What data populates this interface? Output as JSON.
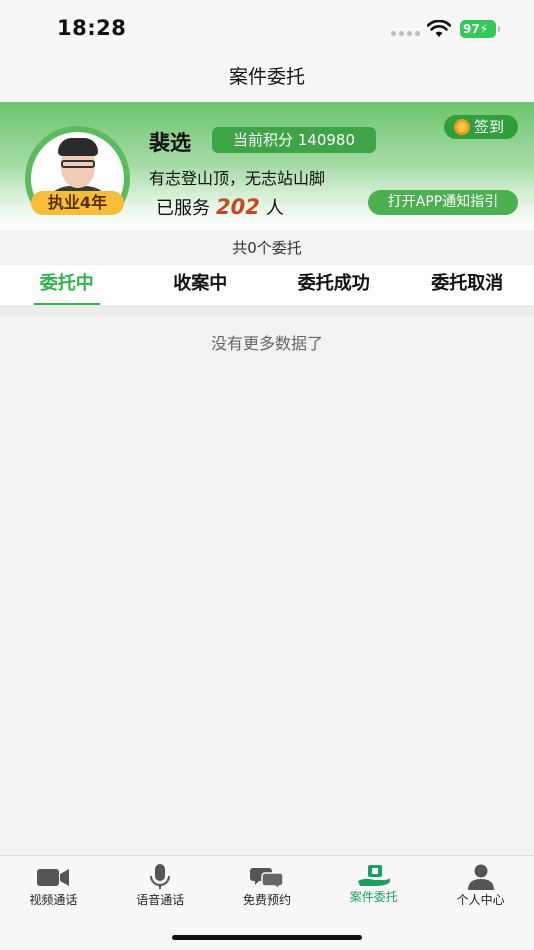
{
  "status": {
    "time": "18:28",
    "battery": "97"
  },
  "nav": {
    "title": "案件委托"
  },
  "profile": {
    "name": "裴选",
    "points_label": "当前积分 140980",
    "signin_label": "签到",
    "motto": "有志登山顶，无志站山脚",
    "served_prefix": "已服务",
    "served_count": "202",
    "served_suffix": "人",
    "years_badge": "执业4年",
    "app_guide_label": "打开APP通知指引"
  },
  "summary": {
    "count_text": "共0个委托"
  },
  "tabs": [
    {
      "label": "委托中",
      "active": true
    },
    {
      "label": "收案中",
      "active": false
    },
    {
      "label": "委托成功",
      "active": false
    },
    {
      "label": "委托取消",
      "active": false
    }
  ],
  "empty_message": "没有更多数据了",
  "tabbar": [
    {
      "label": "视频通话",
      "icon": "video-camera-icon"
    },
    {
      "label": "语音通话",
      "icon": "microphone-icon"
    },
    {
      "label": "免费预约",
      "icon": "chat-bubbles-icon"
    },
    {
      "label": "案件委托",
      "icon": "case-hand-icon",
      "active": true
    },
    {
      "label": "个人中心",
      "icon": "person-icon"
    }
  ],
  "colors": {
    "accent": "#2fb54a",
    "points_bg": "#3ea447",
    "served_count": "#c8481e",
    "badge": "#f6bd3a"
  }
}
